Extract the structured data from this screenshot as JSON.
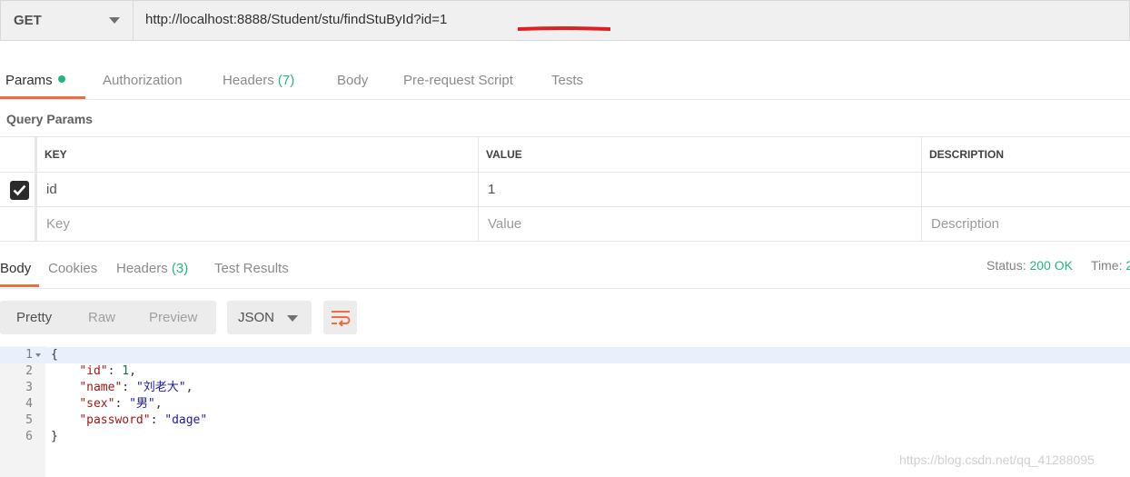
{
  "request": {
    "method": "GET",
    "url": "http://localhost:8888/Student/stu/findStuById?id=1"
  },
  "request_tabs": [
    {
      "label": "Params",
      "active": true
    },
    {
      "label": "Authorization"
    },
    {
      "label": "Headers",
      "count": "(7)"
    },
    {
      "label": "Body"
    },
    {
      "label": "Pre-request Script"
    },
    {
      "label": "Tests"
    }
  ],
  "query_params": {
    "title": "Query Params",
    "headers": [
      "KEY",
      "VALUE",
      "DESCRIPTION"
    ],
    "rows": [
      {
        "checked": true,
        "key": "id",
        "value": "1",
        "description": ""
      }
    ],
    "placeholders": {
      "key": "Key",
      "value": "Value",
      "description": "Description"
    }
  },
  "response_tabs": [
    {
      "label": "Body",
      "active": true
    },
    {
      "label": "Cookies"
    },
    {
      "label": "Headers",
      "count": "(3)"
    },
    {
      "label": "Test Results"
    }
  ],
  "status": {
    "status_label": "Status:",
    "status_value": "200 OK",
    "time_label": "Time:",
    "time_value": "2"
  },
  "view_modes": [
    "Pretty",
    "Raw",
    "Preview"
  ],
  "format": "JSON",
  "colors": {
    "accent": "#f26b3a",
    "success": "#26b47f"
  },
  "icons": {
    "wrap": "wrap-lines-icon",
    "check": "checkmark-icon",
    "dropdown": "chevron-down-icon"
  },
  "response_lines": [
    {
      "n": "1",
      "text": "{"
    },
    {
      "n": "2",
      "key": "\"id\"",
      "val": "1",
      "type": "num",
      "comma": ","
    },
    {
      "n": "3",
      "key": "\"name\"",
      "val": "\"刘老大\"",
      "type": "str",
      "comma": ","
    },
    {
      "n": "4",
      "key": "\"sex\"",
      "val": "\"男\"",
      "type": "str",
      "comma": ","
    },
    {
      "n": "5",
      "key": "\"password\"",
      "val": "\"dage\"",
      "type": "str",
      "comma": ""
    },
    {
      "n": "6",
      "text": "}"
    }
  ],
  "watermark": "https://blog.csdn.net/qq_41288095"
}
